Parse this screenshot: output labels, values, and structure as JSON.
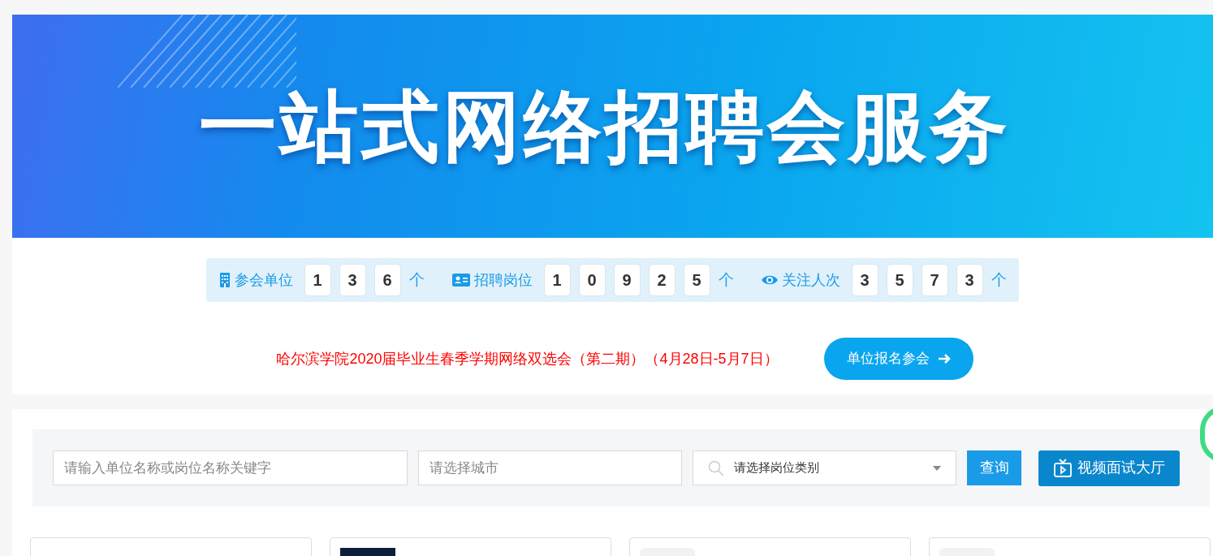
{
  "banner": {
    "title": "一站式网络招聘会服务"
  },
  "stats": [
    {
      "kind": "building",
      "label": "参会单位",
      "digits": [
        "1",
        "3",
        "6"
      ],
      "unit": "个"
    },
    {
      "kind": "card",
      "label": "招聘岗位",
      "digits": [
        "1",
        "0",
        "9",
        "2",
        "5"
      ],
      "unit": "个"
    },
    {
      "kind": "eye",
      "label": "关注人次",
      "digits": [
        "3",
        "5",
        "7",
        "3"
      ],
      "unit": "个"
    }
  ],
  "event": {
    "title": "哈尔滨学院2020届毕业生春季学期网络双选会（第二期）（4月28日-5月7日）",
    "register_button": "单位报名参会"
  },
  "search": {
    "keyword_placeholder": "请输入单位名称或岗位名称关键字",
    "city_placeholder": "请选择城市",
    "category_placeholder": "请选择岗位类别",
    "search_button": "查询",
    "video_button": "视频面试大厅"
  }
}
